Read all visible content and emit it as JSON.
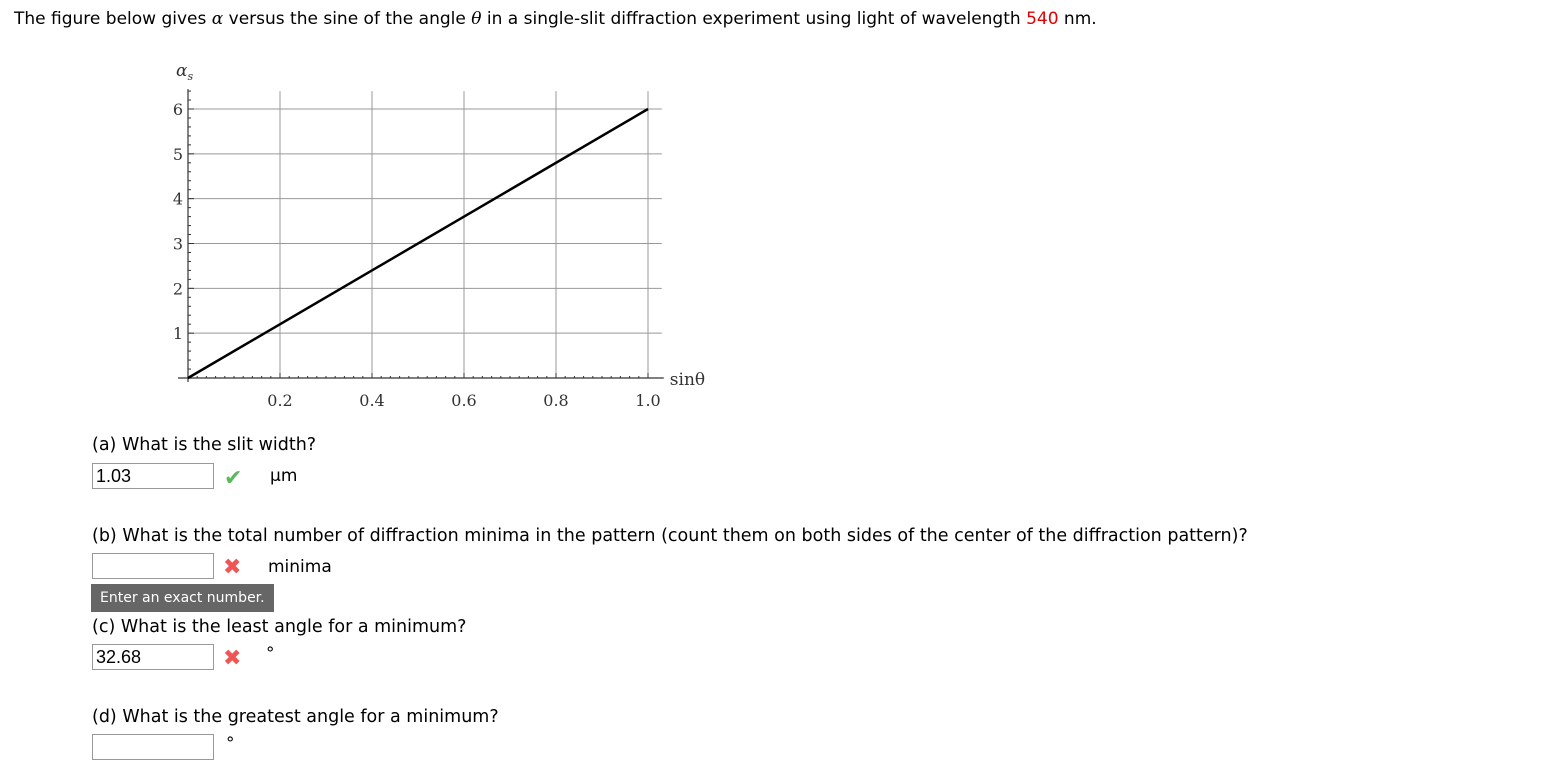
{
  "intro": {
    "before": "The figure below gives ",
    "alpha": "α",
    "mid": " versus the sine of the angle ",
    "theta": "θ",
    "after": " in a single-slit diffraction experiment using light of wavelength ",
    "wavelength": "540",
    "unit": " nm."
  },
  "chart_data": {
    "type": "line",
    "xlabel": "sinθ",
    "ylabel": "αs",
    "xlim": [
      0,
      1.03
    ],
    "ylim": [
      0,
      6.4
    ],
    "x_ticks": [
      "0.2",
      "0.4",
      "0.6",
      "0.8",
      "1.0"
    ],
    "y_ticks": [
      "1",
      "2",
      "3",
      "4",
      "5",
      "6"
    ],
    "grid": true,
    "series": [
      {
        "x": [
          0,
          1.0
        ],
        "y": [
          0,
          6
        ]
      }
    ],
    "line_color": "#000000"
  },
  "questions": {
    "a": {
      "text": "(a) What is the slit width?",
      "value": "1.03",
      "unit": "μm",
      "status": "correct"
    },
    "b": {
      "text": "(b) What is the total number of diffraction minima in the pattern (count them on both sides of the center of the diffraction pattern)?",
      "value": "",
      "unit": "minima",
      "status": "incorrect",
      "tooltip": "Enter an exact number."
    },
    "c": {
      "text": "(c) What is the least angle for a minimum?",
      "value": "32.68",
      "unit": "°",
      "status": "incorrect"
    },
    "d": {
      "text": "(d) What is the greatest angle for a minimum?",
      "value": "",
      "unit": "°"
    }
  },
  "colors": {
    "correct": "#5cb85c",
    "incorrect": "#f05555",
    "highlight": "#e00000"
  }
}
